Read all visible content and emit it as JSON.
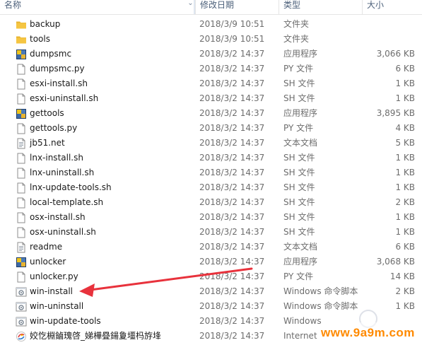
{
  "header": {
    "name": "名称",
    "date": "修改日期",
    "type": "类型",
    "size": "大小"
  },
  "colors": {
    "folder": "#f5c542",
    "arrow": "#e8323c",
    "watermark": "#ff8a00"
  },
  "files": [
    {
      "name": "backup",
      "date": "2018/3/9 10:51",
      "type": "文件夹",
      "size": "",
      "icon": "folder-icon"
    },
    {
      "name": "tools",
      "date": "2018/3/9 10:51",
      "type": "文件夹",
      "size": "",
      "icon": "folder-icon"
    },
    {
      "name": "dumpsmc",
      "date": "2018/3/2 14:37",
      "type": "应用程序",
      "size": "3,066 KB",
      "icon": "application-icon"
    },
    {
      "name": "dumpsmc.py",
      "date": "2018/3/2 14:37",
      "type": "PY 文件",
      "size": "6 KB",
      "icon": "file-icon"
    },
    {
      "name": "esxi-install.sh",
      "date": "2018/3/2 14:37",
      "type": "SH 文件",
      "size": "1 KB",
      "icon": "file-icon"
    },
    {
      "name": "esxi-uninstall.sh",
      "date": "2018/3/2 14:37",
      "type": "SH 文件",
      "size": "1 KB",
      "icon": "file-icon"
    },
    {
      "name": "gettools",
      "date": "2018/3/2 14:37",
      "type": "应用程序",
      "size": "3,895 KB",
      "icon": "application-icon"
    },
    {
      "name": "gettools.py",
      "date": "2018/3/2 14:37",
      "type": "PY 文件",
      "size": "4 KB",
      "icon": "file-icon"
    },
    {
      "name": "jb51.net",
      "date": "2018/3/2 14:37",
      "type": "文本文档",
      "size": "5 KB",
      "icon": "text-file-icon"
    },
    {
      "name": "lnx-install.sh",
      "date": "2018/3/2 14:37",
      "type": "SH 文件",
      "size": "1 KB",
      "icon": "file-icon"
    },
    {
      "name": "lnx-uninstall.sh",
      "date": "2018/3/2 14:37",
      "type": "SH 文件",
      "size": "1 KB",
      "icon": "file-icon"
    },
    {
      "name": "lnx-update-tools.sh",
      "date": "2018/3/2 14:37",
      "type": "SH 文件",
      "size": "1 KB",
      "icon": "file-icon"
    },
    {
      "name": "local-template.sh",
      "date": "2018/3/2 14:37",
      "type": "SH 文件",
      "size": "2 KB",
      "icon": "file-icon"
    },
    {
      "name": "osx-install.sh",
      "date": "2018/3/2 14:37",
      "type": "SH 文件",
      "size": "1 KB",
      "icon": "file-icon"
    },
    {
      "name": "osx-uninstall.sh",
      "date": "2018/3/2 14:37",
      "type": "SH 文件",
      "size": "1 KB",
      "icon": "file-icon"
    },
    {
      "name": "readme",
      "date": "2018/3/2 14:37",
      "type": "文本文档",
      "size": "6 KB",
      "icon": "text-file-icon"
    },
    {
      "name": "unlocker",
      "date": "2018/3/2 14:37",
      "type": "应用程序",
      "size": "3,068 KB",
      "icon": "application-icon"
    },
    {
      "name": "unlocker.py",
      "date": "2018/3/2 14:37",
      "type": "PY 文件",
      "size": "14 KB",
      "icon": "file-icon"
    },
    {
      "name": "win-install",
      "date": "2018/3/2 14:37",
      "type": "Windows 命令脚本",
      "size": "2 KB",
      "icon": "script-icon"
    },
    {
      "name": "win-uninstall",
      "date": "2018/3/2 14:37",
      "type": "Windows 命令脚本",
      "size": "1 KB",
      "icon": "script-icon"
    },
    {
      "name": "win-update-tools",
      "date": "2018/3/2 14:37",
      "type": "Windows",
      "size": "",
      "icon": "script-icon"
    },
    {
      "name": "姣忔棩鏀瑰啓_娣樺疂鍚夐壃杩斿埄",
      "date": "2018/3/2 14:37",
      "type": "Internet",
      "size": "",
      "icon": "internet-shortcut-icon"
    }
  ],
  "watermark": {
    "text": "www.9a9m.com"
  }
}
